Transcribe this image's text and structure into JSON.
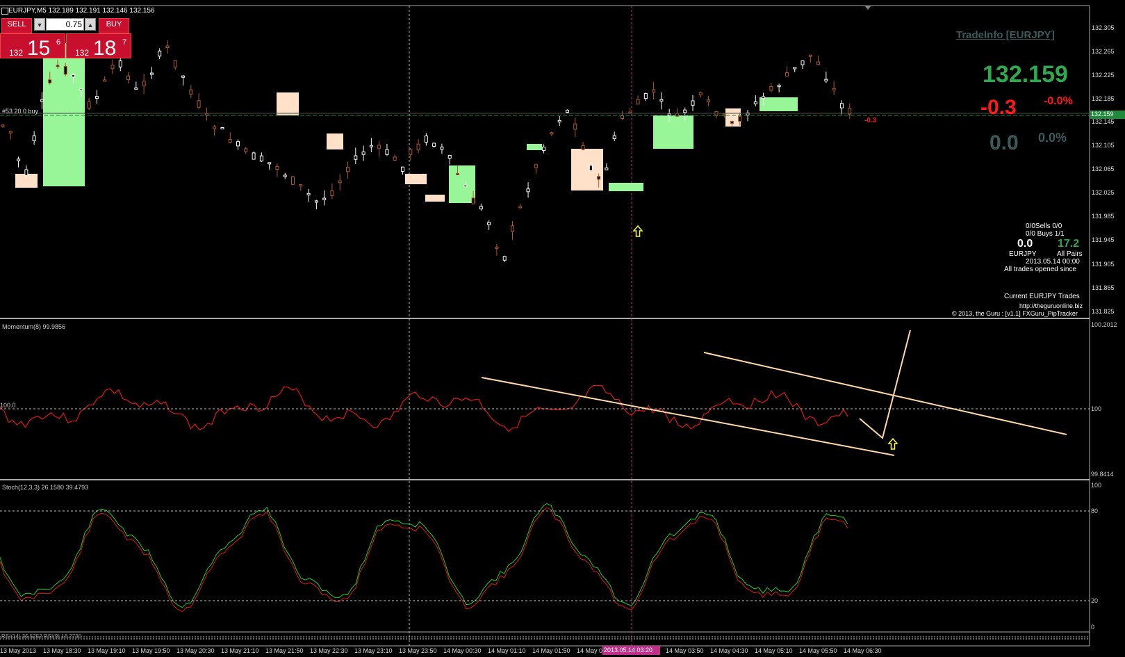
{
  "header": {
    "symbol_line": "EURJPY,M5  132.189 132.191 132.146 132.156"
  },
  "trade_panel": {
    "sell_label": "SELL",
    "buy_label": "BUY",
    "lots_value": "0.75",
    "sell_price_small": "132",
    "sell_price_big": "15",
    "sell_price_sup": "6",
    "buy_price_small": "132",
    "buy_price_big": "18",
    "buy_price_sup": "7",
    "color": "#c8102e"
  },
  "order_line_label": "#53 20 0 buy",
  "tradeinfo": {
    "title": "TradeInfo [EURJPY]",
    "price": "132.159",
    "change": "-0.3",
    "change_pct": "-0.0%",
    "pips": "0.0",
    "pips_pct": "0.0%",
    "price_color": "#2fa84f",
    "change_color": "#ff1a1a",
    "pips_color": "#3d5a5a"
  },
  "price_tag": "-0.3",
  "current_price_label": "132.159",
  "pip_tracker": {
    "sells_line": "0/0Sells   0/0",
    "buys_line": "0/0 Buys   1/1",
    "eurjpy_value": "0.0",
    "all_value": "17.2",
    "eurjpy_label": "EURJPY",
    "all_label": "All Pairs",
    "date": "2013.05.14 00:00",
    "opened_since": "All trades opened since",
    "current_trades": "Current EURJPY Trades",
    "url": "http://theguruonline.biz",
    "copyright": "© 2013, the Guru : [v1.1] FXGuru_PipTracker"
  },
  "price_axis": [
    "132.305",
    "132.265",
    "132.225",
    "132.185",
    "132.145",
    "132.105",
    "132.065",
    "132.025",
    "131.985",
    "131.945",
    "131.905",
    "131.865",
    "131.825"
  ],
  "momentum": {
    "label": "Momentum(8) 99.9856",
    "axis_top": "100.2012",
    "axis_mid": "100",
    "axis_bottom": "99.8414",
    "level_left": "100.0"
  },
  "stoch": {
    "label": "Stoch(12,3,3) 26.1580 39.4793",
    "axis_100": "100",
    "axis_80": "80",
    "axis_20": "20",
    "axis_0": "0"
  },
  "rsi_label": "RSI(14) 35.5252  RSI(9) 18.2730",
  "time_axis": [
    "13 May 2013",
    "13 May 18:30",
    "13 May 19:10",
    "13 May 19:50",
    "13 May 20:30",
    "13 May 21:10",
    "13 May 21:50",
    "13 May 22:30",
    "13 May 23:10",
    "13 May 23:50",
    "14 May 00:30",
    "14 May 01:10",
    "14 May 01:50",
    "14 May 0",
    "14 May 03:50",
    "14 May 04:30",
    "14 May 05:10",
    "14 May 05:50",
    "14 May 06:30"
  ],
  "crosshair_time": "2013.05.14 03:20"
}
